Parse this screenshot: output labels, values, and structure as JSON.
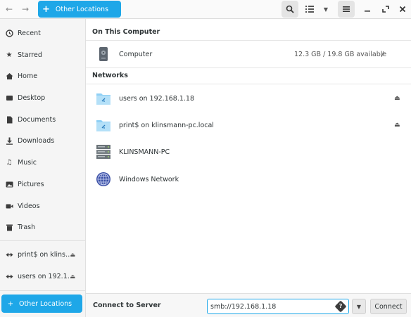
{
  "header": {
    "location_label": "Other Locations"
  },
  "sidebar": {
    "items": [
      {
        "label": "Recent",
        "icon": "clock-icon"
      },
      {
        "label": "Starred",
        "icon": "star-icon"
      },
      {
        "label": "Home",
        "icon": "home-icon"
      },
      {
        "label": "Desktop",
        "icon": "desktop-icon"
      },
      {
        "label": "Documents",
        "icon": "document-icon"
      },
      {
        "label": "Downloads",
        "icon": "download-icon"
      },
      {
        "label": "Music",
        "icon": "music-icon"
      },
      {
        "label": "Pictures",
        "icon": "picture-icon"
      },
      {
        "label": "Videos",
        "icon": "video-icon"
      },
      {
        "label": "Trash",
        "icon": "trash-icon"
      }
    ],
    "network_mounts": [
      {
        "label": "print$ on klins…",
        "icon": "network-icon"
      },
      {
        "label": "users on 192.1…",
        "icon": "network-icon"
      }
    ],
    "other_locations": "Other Locations"
  },
  "main": {
    "on_this_computer_title": "On This Computer",
    "computer": {
      "name": "Computer",
      "usage": "12.3 GB / 19.8 GB available",
      "path": "/"
    },
    "networks_title": "Networks",
    "networks": [
      {
        "name": "users on 192.168.1.18",
        "icon": "network-folder-icon"
      },
      {
        "name": "print$ on klinsmann-pc.local",
        "icon": "network-folder-icon"
      },
      {
        "name": "KLINSMANN-PC",
        "icon": "server-icon"
      },
      {
        "name": "Windows Network",
        "icon": "globe-icon"
      }
    ]
  },
  "bottom": {
    "label": "Connect to Server",
    "server_value": "smb://192.168.1.18",
    "connect_label": "Connect"
  },
  "colors": {
    "accent": "#1ea7e8"
  }
}
